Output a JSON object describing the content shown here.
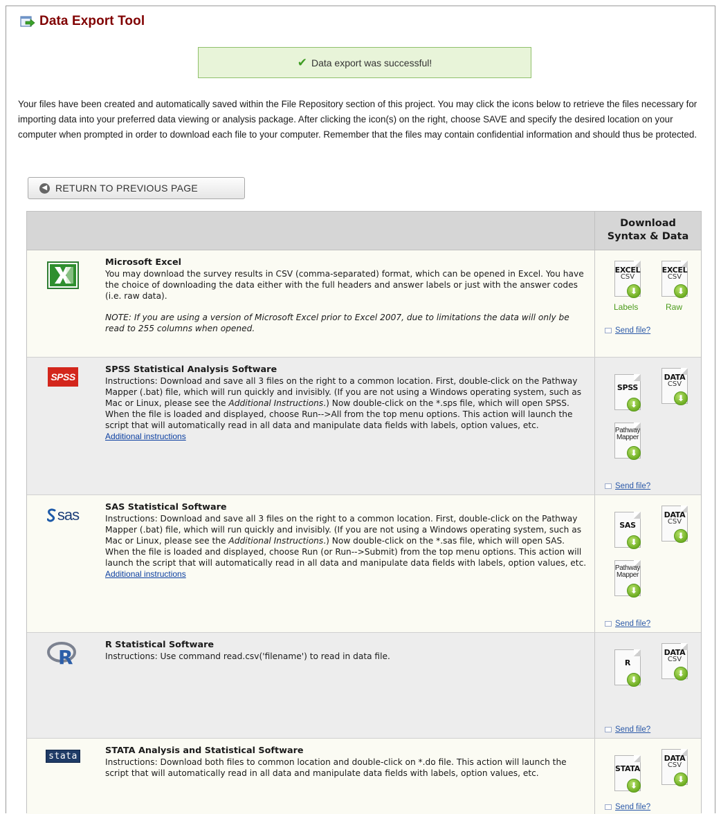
{
  "page": {
    "title": "Data Export Tool",
    "success_message": "Data export was successful!",
    "intro": "Your files have been created and automatically saved within the File Repository section of this project. You may click the icons below to retrieve the files necessary for importing data into your preferred data viewing or analysis package. After clicking the icon(s) on the right, choose SAVE and specify the desired location on your computer when prompted in order to download each file to your computer. Remember that the files may contain confidential information and should thus be protected.",
    "return_button": "RETURN TO PREVIOUS PAGE"
  },
  "table": {
    "header_right_line1": "Download",
    "header_right_line2": "Syntax & Data"
  },
  "send_file_label": "Send file?",
  "additional_instructions_label": "Additional instructions",
  "rows": [
    {
      "name": "Microsoft Excel",
      "text": "You may download the survey results in CSV (comma-separated) format, which can be opened in Excel. You have the choice of downloading the data either with the full headers and answer labels or just with the answer codes (i.e. raw data).",
      "note": "NOTE: If you are using a version of Microsoft Excel prior to Excel 2007, due to limitations the data will only be read to 255 columns when opened.",
      "files": [
        {
          "line1": "EXCEL",
          "line2": "CSV",
          "label": "Labels"
        },
        {
          "line1": "EXCEL",
          "line2": "CSV",
          "label": "Raw"
        }
      ]
    },
    {
      "name": "SPSS Statistical Analysis Software",
      "text_parts": {
        "a": "Instructions: Download and save all 3 files on the right to a common location. First, double-click on the Pathway Mapper (.bat) file, which will run quickly and invisibly. (If you are not using a Windows operating system, such as Mac or Linux, please see the ",
        "b": "Additional Instructions",
        "c": ".) Now double-click on the *.sps file, which will open SPSS. When the file is loaded and displayed, choose Run-->All from the top menu options. This action will launch the script that will automatically read in all data and manipulate data fields with labels, option values, etc."
      },
      "files": [
        {
          "line1": "SPSS",
          "line2": ""
        },
        {
          "line1": "DATA",
          "line2": "CSV"
        },
        {
          "pm1": "Pathway",
          "pm2": "Mapper"
        }
      ],
      "logo_text": "SPSS"
    },
    {
      "name": "SAS Statistical Software",
      "text_parts": {
        "a": "Instructions: Download and save all 3 files on the right to a common location. First, double-click on the Pathway Mapper (.bat) file, which will run quickly and invisibly. (If you are not using a Windows operating system, such as Mac or Linux, please see the ",
        "b": "Additional Instructions",
        "c": ".) Now double-click on the *.sas file, which will open SAS. When the file is loaded and displayed, choose Run (or Run-->Submit) from the top menu options. This action will launch the script that will automatically read in all data and manipulate data fields with labels, option values, etc."
      },
      "files": [
        {
          "line1": "SAS",
          "line2": ""
        },
        {
          "line1": "DATA",
          "line2": "CSV"
        },
        {
          "pm1": "Pathway",
          "pm2": "Mapper"
        }
      ],
      "logo_text": "sas"
    },
    {
      "name": "R Statistical Software",
      "text": "Instructions: Use command read.csv('filename') to read in data file.",
      "files": [
        {
          "line1": "R",
          "line2": ""
        },
        {
          "line1": "DATA",
          "line2": "CSV"
        }
      ],
      "logo_text": "R"
    },
    {
      "name": "STATA Analysis and Statistical Software",
      "text": "Instructions: Download both files to common location and double-click on *.do file. This action will launch the script that will automatically read in all data and manipulate data fields with labels, option values, etc.",
      "files": [
        {
          "line1": "STATA",
          "line2": ""
        },
        {
          "line1": "DATA",
          "line2": "CSV"
        }
      ],
      "logo_text": "stata"
    }
  ],
  "colors": {
    "title": "#800000",
    "success_bg": "#e8f4d9",
    "success_border": "#8fc06a",
    "download_green": "#6fae23",
    "link_blue": "#2a58a8"
  }
}
